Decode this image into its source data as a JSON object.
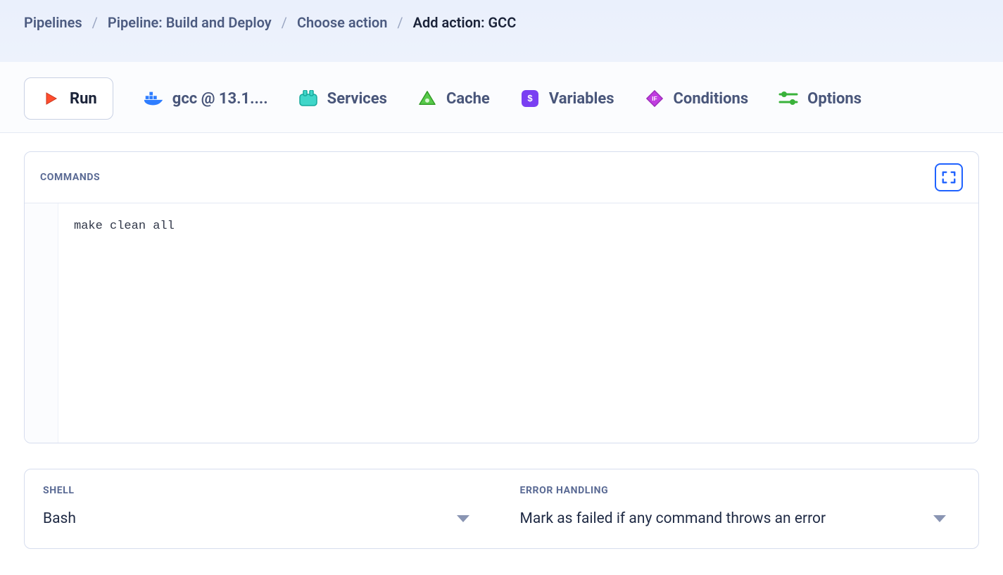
{
  "breadcrumb": {
    "items": [
      {
        "label": "Pipelines"
      },
      {
        "label": "Pipeline: Build and Deploy"
      },
      {
        "label": "Choose action"
      }
    ],
    "current": "Add action: GCC"
  },
  "tabs": {
    "run": "Run",
    "env": "gcc @ 13.1....",
    "services": "Services",
    "cache": "Cache",
    "variables": "Variables",
    "conditions": "Conditions",
    "options": "Options"
  },
  "commands": {
    "label": "COMMANDS",
    "code": "make clean all"
  },
  "shell": {
    "label": "SHELL",
    "value": "Bash"
  },
  "errorHandling": {
    "label": "ERROR HANDLING",
    "value": "Mark as failed if any command throws an error"
  }
}
